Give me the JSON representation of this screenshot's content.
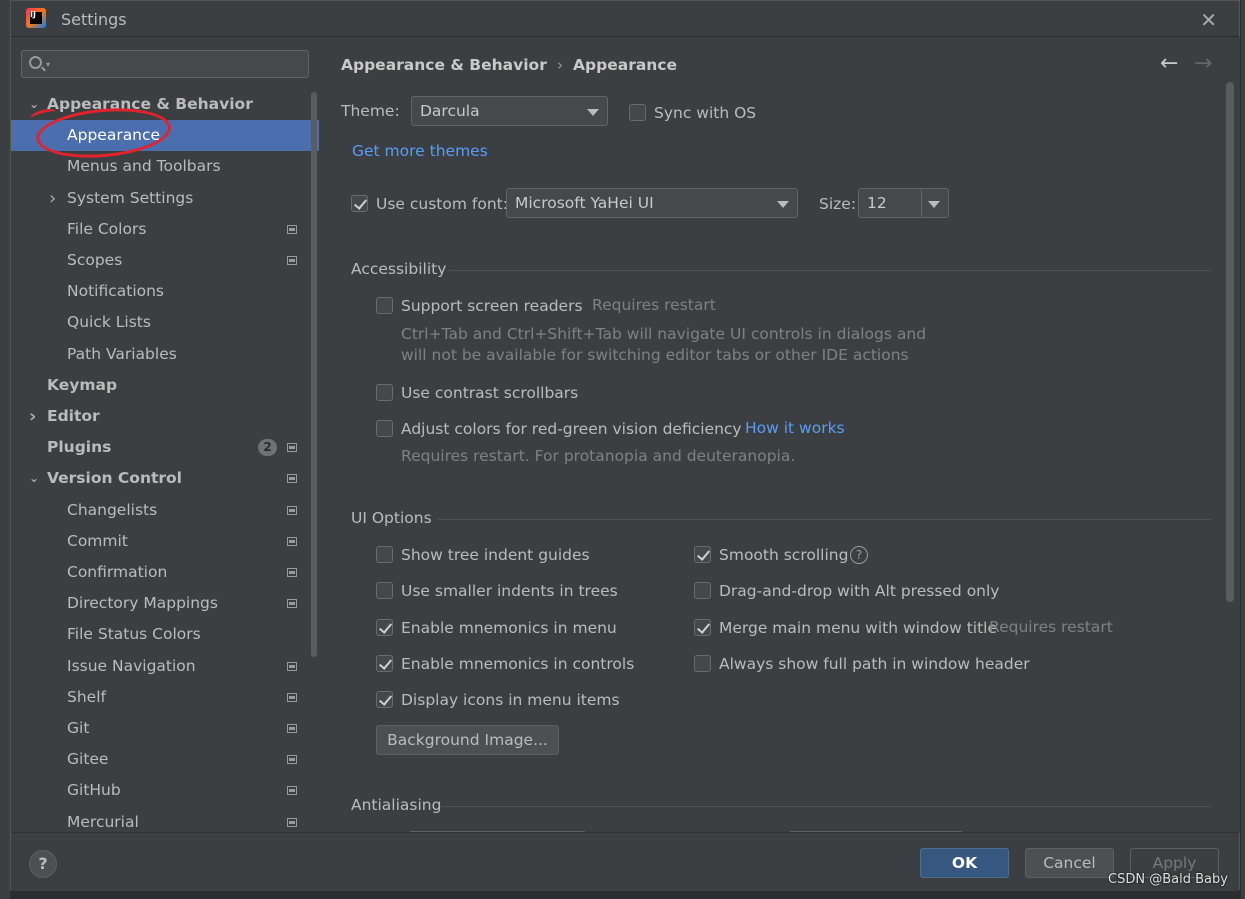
{
  "window": {
    "title": "Settings"
  },
  "search": {
    "placeholder": ""
  },
  "sidebar": {
    "items": [
      {
        "label": "Appearance & Behavior",
        "bold": true,
        "arrow": "down",
        "indent": 0
      },
      {
        "label": "Appearance",
        "selected": true,
        "indent": 1
      },
      {
        "label": "Menus and Toolbars",
        "indent": 1
      },
      {
        "label": "System Settings",
        "arrow": "right",
        "indent": 1
      },
      {
        "label": "File Colors",
        "gear": true,
        "indent": 1
      },
      {
        "label": "Scopes",
        "gear": true,
        "indent": 1
      },
      {
        "label": "Notifications",
        "indent": 1
      },
      {
        "label": "Quick Lists",
        "indent": 1
      },
      {
        "label": "Path Variables",
        "indent": 1
      },
      {
        "label": "Keymap",
        "bold": true,
        "indent": 0
      },
      {
        "label": "Editor",
        "bold": true,
        "arrow": "right",
        "indent": 0
      },
      {
        "label": "Plugins",
        "bold": true,
        "badge": "2",
        "gear": true,
        "indent": 0
      },
      {
        "label": "Version Control",
        "bold": true,
        "arrow": "down",
        "gear": true,
        "indent": 0
      },
      {
        "label": "Changelists",
        "gear": true,
        "indent": 1
      },
      {
        "label": "Commit",
        "gear": true,
        "indent": 1
      },
      {
        "label": "Confirmation",
        "gear": true,
        "indent": 1
      },
      {
        "label": "Directory Mappings",
        "gear": true,
        "indent": 1
      },
      {
        "label": "File Status Colors",
        "indent": 1
      },
      {
        "label": "Issue Navigation",
        "gear": true,
        "indent": 1
      },
      {
        "label": "Shelf",
        "gear": true,
        "indent": 1
      },
      {
        "label": "Git",
        "gear": true,
        "indent": 1
      },
      {
        "label": "Gitee",
        "gear": true,
        "indent": 1
      },
      {
        "label": "GitHub",
        "gear": true,
        "indent": 1
      },
      {
        "label": "Mercurial",
        "gear": true,
        "indent": 1
      }
    ]
  },
  "breadcrumb": {
    "parent": "Appearance & Behavior",
    "sep": "›",
    "current": "Appearance"
  },
  "theme": {
    "label": "Theme:",
    "value": "Darcula",
    "sync_label": "Sync with OS",
    "sync_checked": false
  },
  "more_themes": "Get more themes",
  "font": {
    "custom_label": "Use custom font:",
    "custom_checked": true,
    "value": "Microsoft YaHei UI",
    "size_label": "Size:",
    "size_value": "12"
  },
  "accessibility": {
    "title": "Accessibility",
    "screen_readers": {
      "label": "Support screen readers",
      "note": "Requires restart",
      "checked": false
    },
    "screen_readers_desc_1": "Ctrl+Tab and Ctrl+Shift+Tab will navigate UI controls in dialogs and",
    "screen_readers_desc_2": "will not be available for switching editor tabs or other IDE actions",
    "contrast": {
      "label": "Use contrast scrollbars",
      "checked": false
    },
    "color_def": {
      "label": "Adjust colors for red-green vision deficiency",
      "link": "How it works",
      "checked": false
    },
    "color_def_desc": "Requires restart. For protanopia and deuteranopia."
  },
  "ui_options": {
    "title": "UI Options",
    "left": [
      {
        "label": "Show tree indent guides",
        "checked": false
      },
      {
        "label": "Use smaller indents in trees",
        "checked": false
      },
      {
        "label": "Enable mnemonics in menu",
        "checked": true
      },
      {
        "label": "Enable mnemonics in controls",
        "checked": true
      },
      {
        "label": "Display icons in menu items",
        "checked": true
      }
    ],
    "right": [
      {
        "label": "Smooth scrolling",
        "checked": true,
        "help": "?"
      },
      {
        "label": "Drag-and-drop with Alt pressed only",
        "checked": false
      },
      {
        "label": "Merge main menu with window title",
        "checked": true,
        "note": "Requires restart"
      },
      {
        "label": "Always show full path in window header",
        "checked": false
      }
    ],
    "bg_button": "Background Image..."
  },
  "antialiasing": {
    "title": "Antialiasing"
  },
  "footer": {
    "help": "?",
    "ok": "OK",
    "cancel": "Cancel",
    "apply": "Apply"
  },
  "watermark": "CSDN @Bald Baby",
  "colors": {
    "selection": "#4b6eaf",
    "link": "#589df6",
    "primary_button": "#365880",
    "annotation": "#e3222b"
  }
}
